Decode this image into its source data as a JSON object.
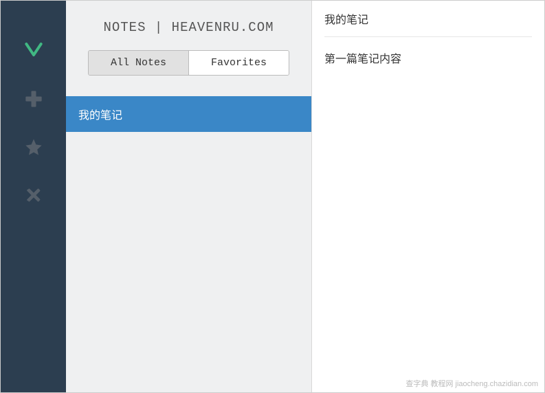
{
  "sidebar": {
    "icons": [
      {
        "name": "vue-logo"
      },
      {
        "name": "plus"
      },
      {
        "name": "star"
      },
      {
        "name": "close"
      }
    ]
  },
  "notesPanel": {
    "title": "NOTES | HEAVENRU.COM",
    "tabs": {
      "allNotes": "All Notes",
      "favorites": "Favorites"
    },
    "noteItem": "我的笔记"
  },
  "content": {
    "title": "我的笔记",
    "body": "第一篇笔记内容"
  },
  "watermark": "查字典 教程网 jiaocheng.chazidian.com"
}
